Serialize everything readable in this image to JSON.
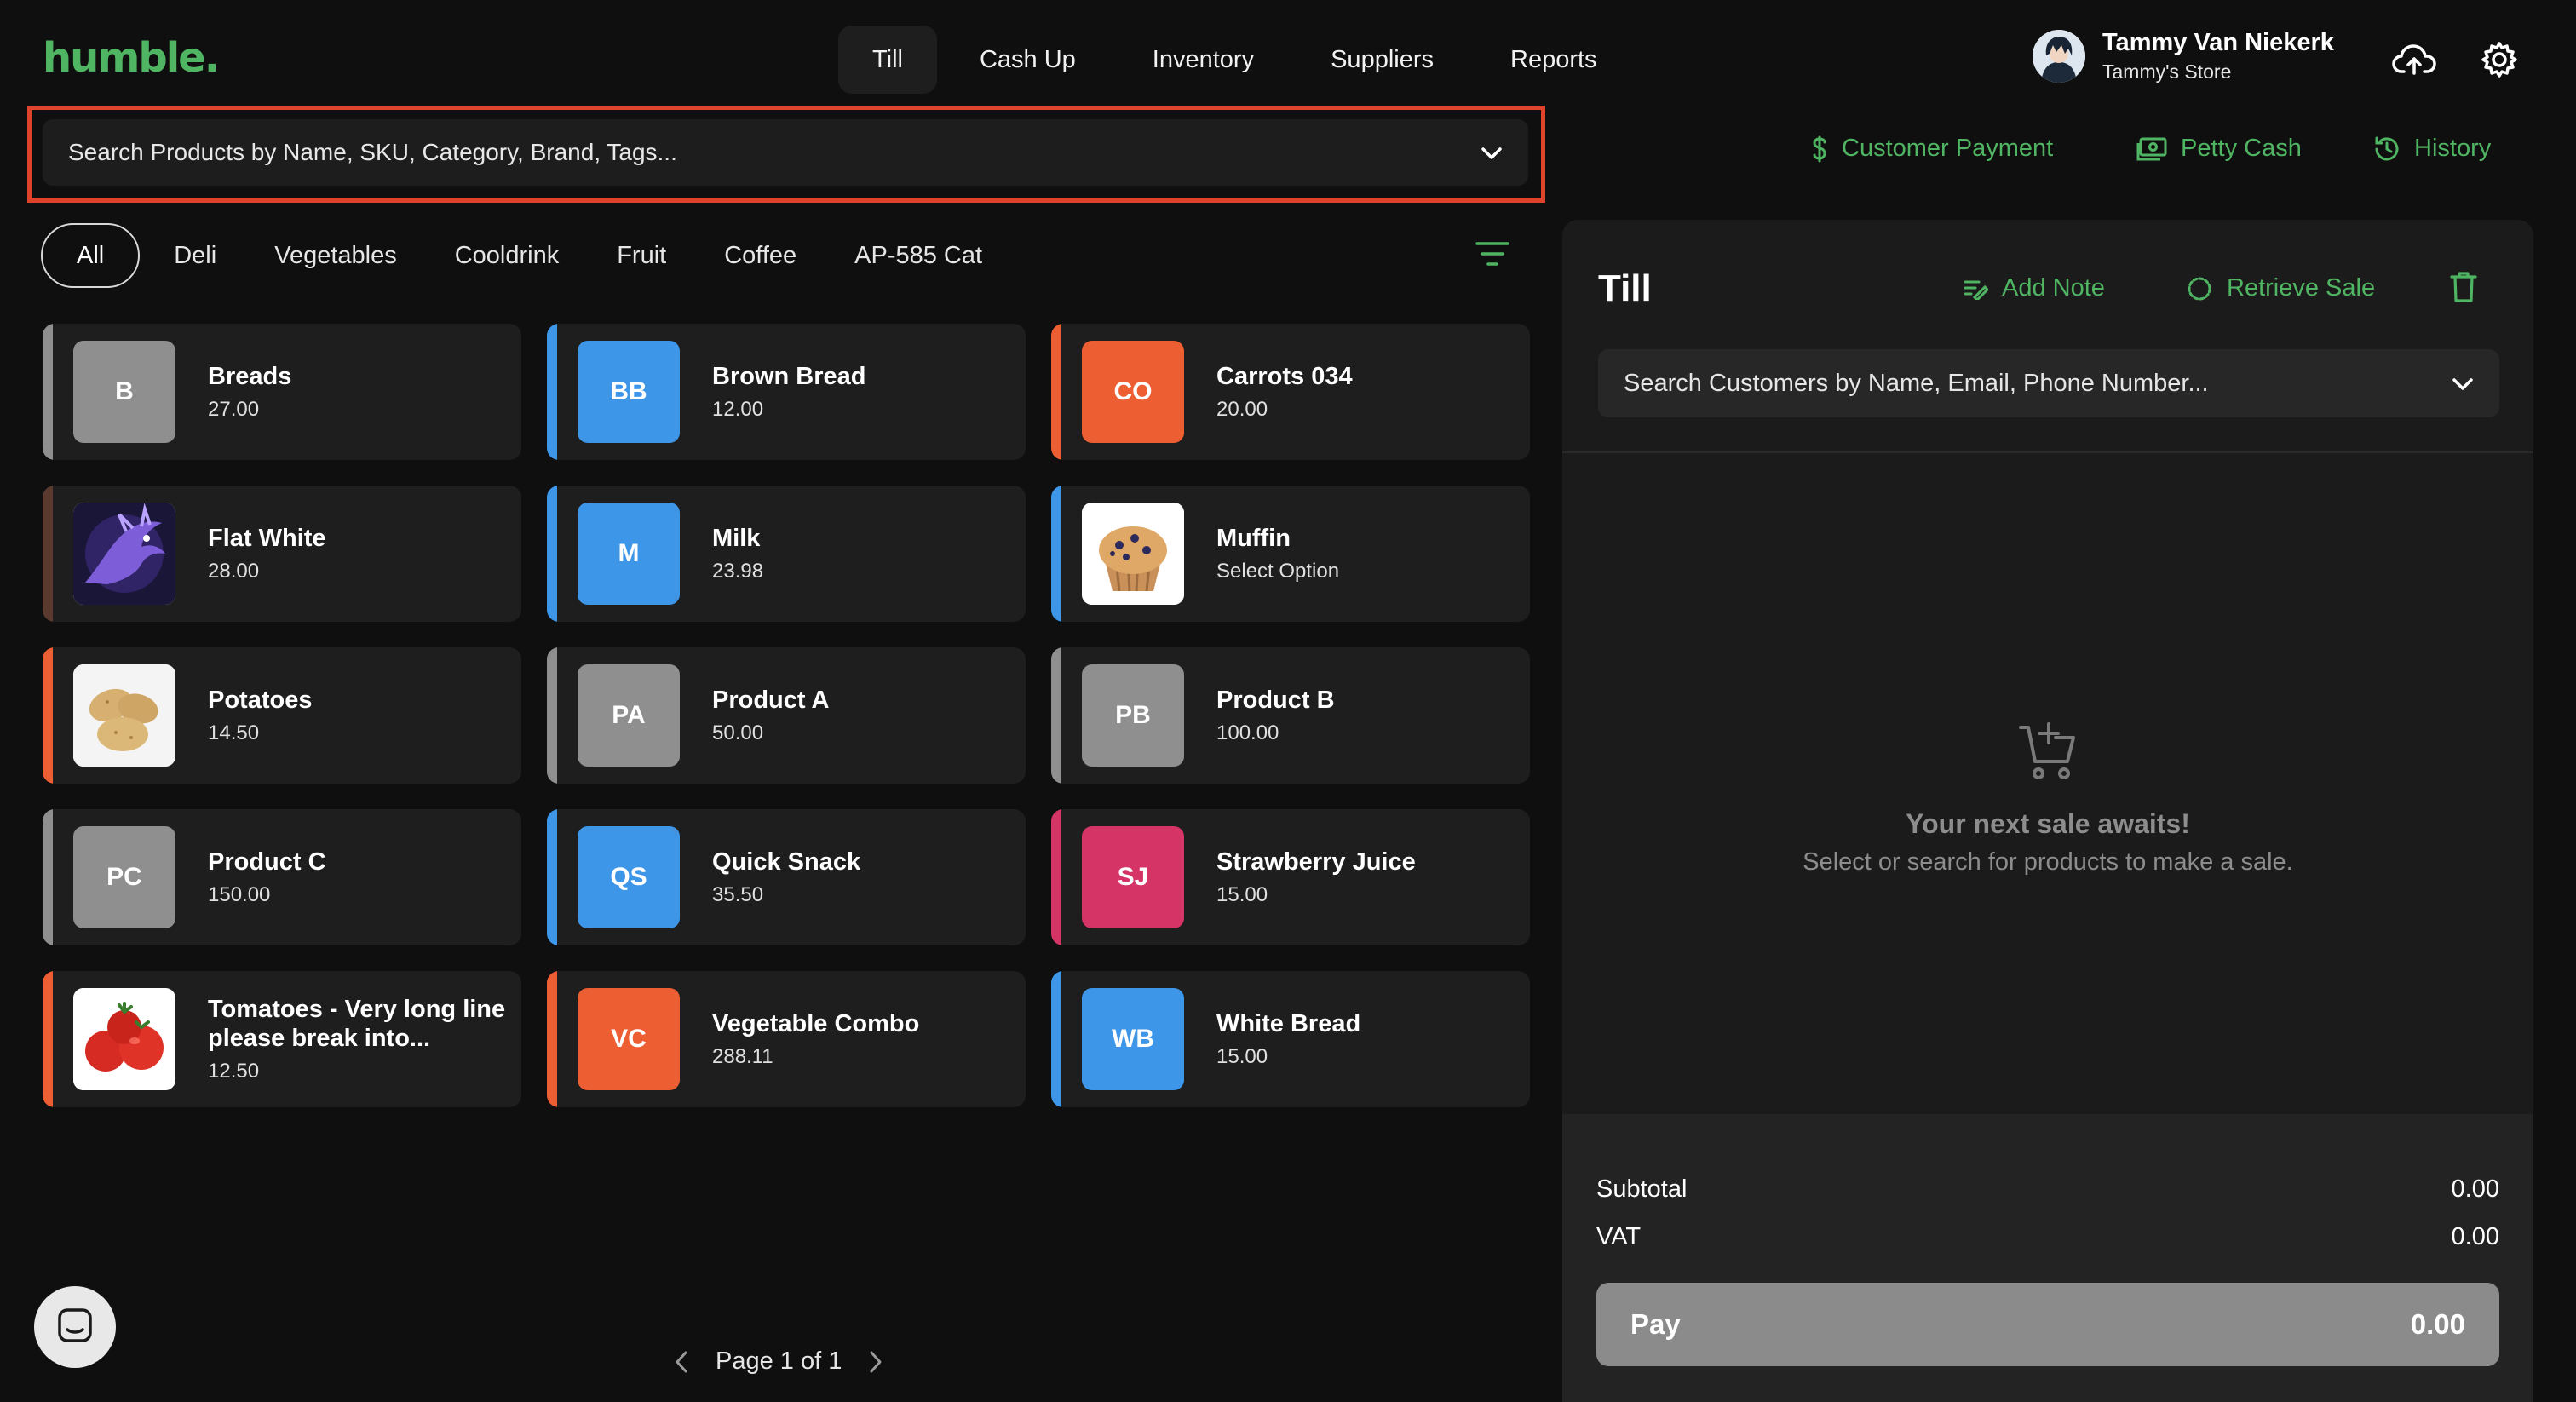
{
  "brand": {
    "logo": "humble.",
    "accent": "#4fb562"
  },
  "nav": {
    "tabs": [
      {
        "label": "Till",
        "active": true
      },
      {
        "label": "Cash Up"
      },
      {
        "label": "Inventory"
      },
      {
        "label": "Suppliers"
      },
      {
        "label": "Reports"
      }
    ]
  },
  "user": {
    "name": "Tammy Van Niekerk",
    "store": "Tammy's Store"
  },
  "icons": {
    "cloud": "cloud-upload-icon",
    "settings": "gear-icon"
  },
  "product_search": {
    "placeholder": "Search Products by Name, SKU, Category, Brand, Tags..."
  },
  "quick_links": {
    "customer_payment": "Customer Payment",
    "petty_cash": "Petty Cash",
    "history": "History"
  },
  "categories": [
    "All",
    "Deli",
    "Vegetables",
    "Cooldrink",
    "Fruit",
    "Coffee",
    "AP-585 Cat"
  ],
  "products": [
    {
      "name": "Breads",
      "price": "27.00",
      "initials": "B",
      "color": "#8f8f8f"
    },
    {
      "name": "Brown Bread",
      "price": "12.00",
      "initials": "BB",
      "color": "#3d96e8"
    },
    {
      "name": "Carrots 034",
      "price": "20.00",
      "initials": "CO",
      "color": "#ee5e33"
    },
    {
      "name": "Flat White",
      "price": "28.00",
      "image": "dragon",
      "color": "#5a3a2e"
    },
    {
      "name": "Milk",
      "price": "23.98",
      "initials": "M",
      "color": "#3d96e8"
    },
    {
      "name": "Muffin",
      "price": "Select Option",
      "image": "muffin",
      "color": "#3d96e8"
    },
    {
      "name": "Potatoes",
      "price": "14.50",
      "image": "potato",
      "color": "#ee5e33"
    },
    {
      "name": "Product A",
      "price": "50.00",
      "initials": "PA",
      "color": "#8f8f8f"
    },
    {
      "name": "Product B",
      "price": "100.00",
      "initials": "PB",
      "color": "#8f8f8f"
    },
    {
      "name": "Product C",
      "price": "150.00",
      "initials": "PC",
      "color": "#8f8f8f"
    },
    {
      "name": "Quick Snack",
      "price": "35.50",
      "initials": "QS",
      "color": "#3d96e8"
    },
    {
      "name": "Strawberry Juice",
      "price": "15.00",
      "initials": "SJ",
      "color": "#d43466"
    },
    {
      "name": "Tomatoes - Very long line please break into...",
      "price": "12.50",
      "image": "tomato",
      "color": "#ee5e33"
    },
    {
      "name": "Vegetable Combo",
      "price": "288.11",
      "initials": "VC",
      "color": "#ee5e33"
    },
    {
      "name": "White Bread",
      "price": "15.00",
      "initials": "WB",
      "color": "#3d96e8"
    }
  ],
  "pagination": {
    "label": "Page 1 of 1"
  },
  "till": {
    "title": "Till",
    "add_note": "Add Note",
    "retrieve_sale": "Retrieve Sale",
    "customer_search_placeholder": "Search Customers by Name, Email, Phone Number...",
    "empty_title": "Your next sale awaits!",
    "empty_sub": "Select or search for products to make a sale.",
    "subtotal_label": "Subtotal",
    "subtotal_value": "0.00",
    "vat_label": "VAT",
    "vat_value": "0.00",
    "pay_label": "Pay",
    "pay_value": "0.00"
  }
}
